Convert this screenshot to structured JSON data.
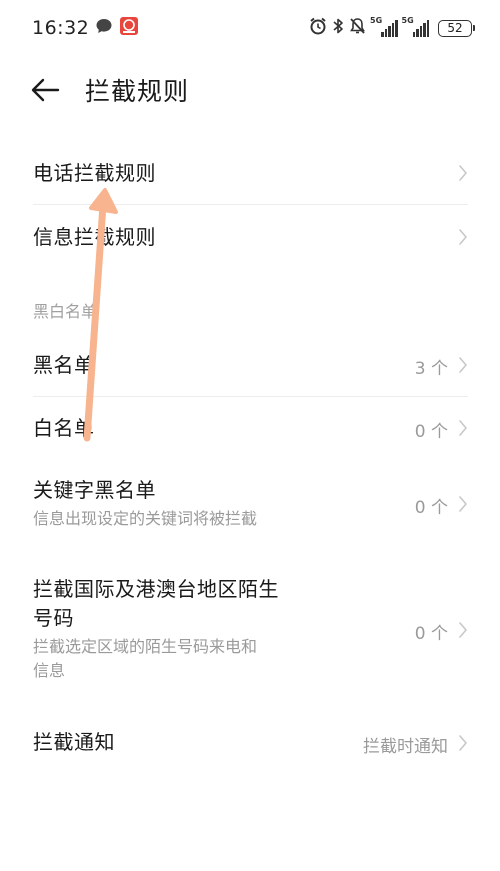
{
  "status_bar": {
    "time": "16:32",
    "network_1": "5G",
    "network_2": "5G",
    "battery": "52"
  },
  "header": {
    "title": "拦截规则"
  },
  "items": {
    "call_rules": {
      "title": "电话拦截规则"
    },
    "message_rules": {
      "title": "信息拦截规则"
    },
    "blacklist": {
      "title": "黑名单",
      "value": "3 个"
    },
    "whitelist": {
      "title": "白名单",
      "value": "0 个"
    },
    "keyword_blacklist": {
      "title": "关键字黑名单",
      "subtitle": "信息出现设定的关键词将被拦截",
      "value": "0 个"
    },
    "intl_block": {
      "title_line1": "拦截国际及港澳台地区陌生",
      "title_line2": "号码",
      "subtitle_line1": "拦截选定区域的陌生号码来电和",
      "subtitle_line2": "信息",
      "value": "0 个"
    },
    "notification": {
      "title": "拦截通知",
      "value": "拦截时通知"
    }
  },
  "sections": {
    "black_white": "黑白名单"
  },
  "colors": {
    "text_primary": "#1a1a1a",
    "text_secondary": "#9a9a9a",
    "divider": "#ededed",
    "annotation_arrow": "#f7b48f"
  },
  "icons": {
    "back": "arrow-left-icon",
    "chevron": "chevron-right-icon",
    "alarm": "alarm-icon",
    "bluetooth": "bluetooth-icon",
    "mute": "bell-off-icon",
    "message": "chat-bubble-icon",
    "app": "app-badge-icon"
  }
}
